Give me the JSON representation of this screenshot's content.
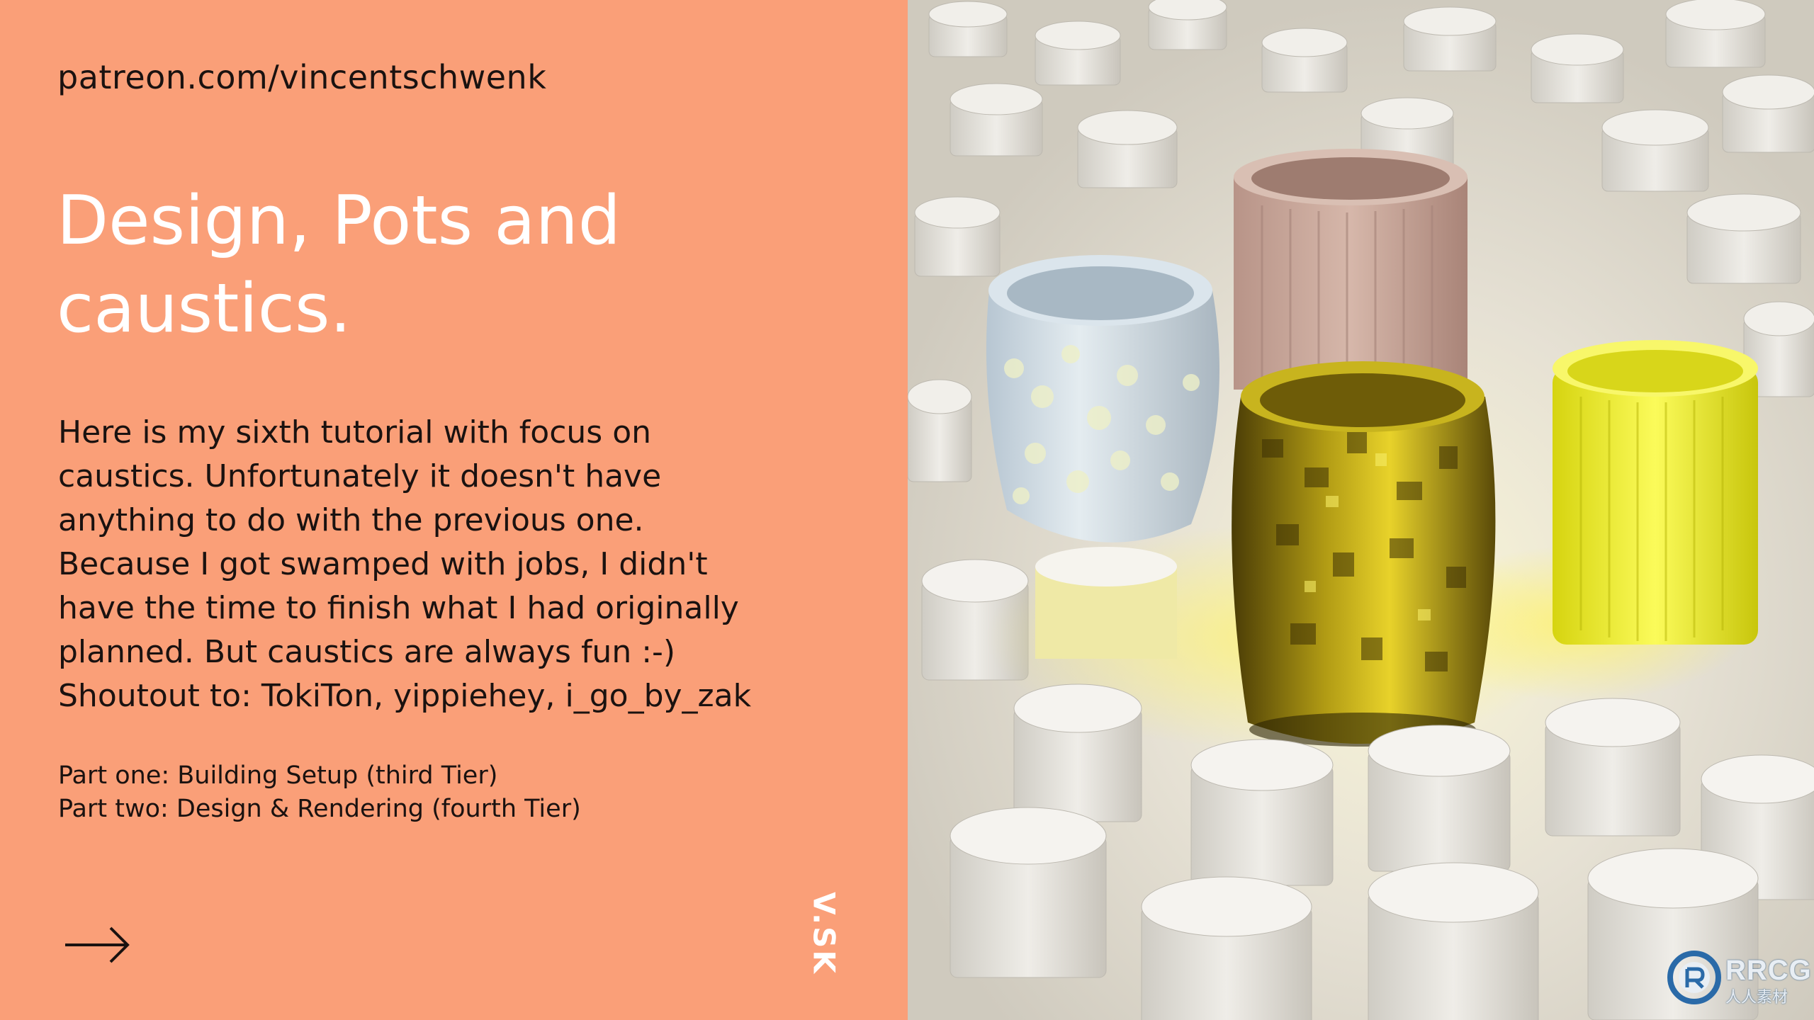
{
  "header": {
    "url": "patreon.com/vincentschwenk"
  },
  "title": {
    "line1": "Design, Pots and",
    "line2": "caustics."
  },
  "description": {
    "lines": [
      "Here is my sixth tutorial with focus on",
      "caustics. Unfortunately it doesn't have",
      "anything to do with the previous one.",
      "Because I got swamped with jobs, I didn't",
      "have the time to finish what I had originally",
      "planned. But caustics are always fun :-)",
      "Shoutout to: TokiTon, yippiehey, i_go_by_zak"
    ]
  },
  "parts": {
    "part_one": "Part one: Building Setup (third Tier)",
    "part_two": "Part two: Design & Rendering (fourth Tier)"
  },
  "branding": {
    "signature": "V.SK"
  },
  "watermark": {
    "text": "RRCG",
    "sub": "人人素材"
  },
  "icons": {
    "next": "arrow-right-icon",
    "logo": "rrcg-logo-icon"
  },
  "colors": {
    "panel_bg": "#fa9f78",
    "title_text": "#ffffff",
    "body_text": "#1a1210",
    "pot_blue": "#c9d6e0",
    "pot_pink": "#c8a89c",
    "pot_olive": "#8a7a10",
    "pot_yellow": "#ecec20"
  }
}
